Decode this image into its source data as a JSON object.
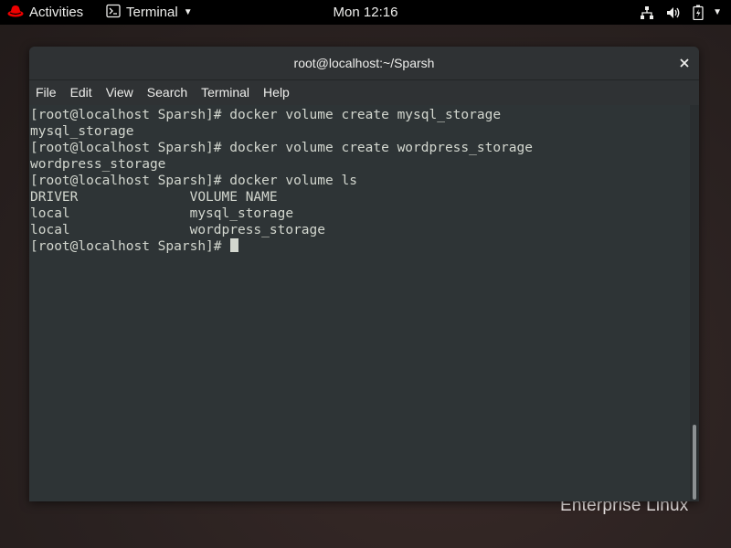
{
  "topbar": {
    "activities_label": "Activities",
    "app_label": "Terminal",
    "clock": "Mon 12:16"
  },
  "window": {
    "title": "root@localhost:~/Sparsh",
    "close_glyph": "×"
  },
  "menubar": {
    "items": [
      "File",
      "Edit",
      "View",
      "Search",
      "Terminal",
      "Help"
    ]
  },
  "terminal": {
    "lines": [
      "[root@localhost Sparsh]# docker volume create mysql_storage",
      "mysql_storage",
      "[root@localhost Sparsh]# docker volume create wordpress_storage",
      "wordpress_storage",
      "[root@localhost Sparsh]# docker volume ls",
      "DRIVER              VOLUME NAME",
      "local               mysql_storage",
      "local               wordpress_storage"
    ],
    "prompt": "[root@localhost Sparsh]# "
  },
  "watermark": "Enterprise Linux",
  "icons": {
    "os_logo": "redhat-logo-icon",
    "app": "terminal-app-icon",
    "network": "network-icon",
    "volume": "volume-icon",
    "battery": "battery-icon",
    "system_menu": "chevron-down-icon"
  },
  "colors": {
    "topbar_bg": "#000000",
    "terminal_bg": "#2e3436",
    "terminal_fg": "#d3d7cf",
    "logo_red": "#ee0000"
  }
}
